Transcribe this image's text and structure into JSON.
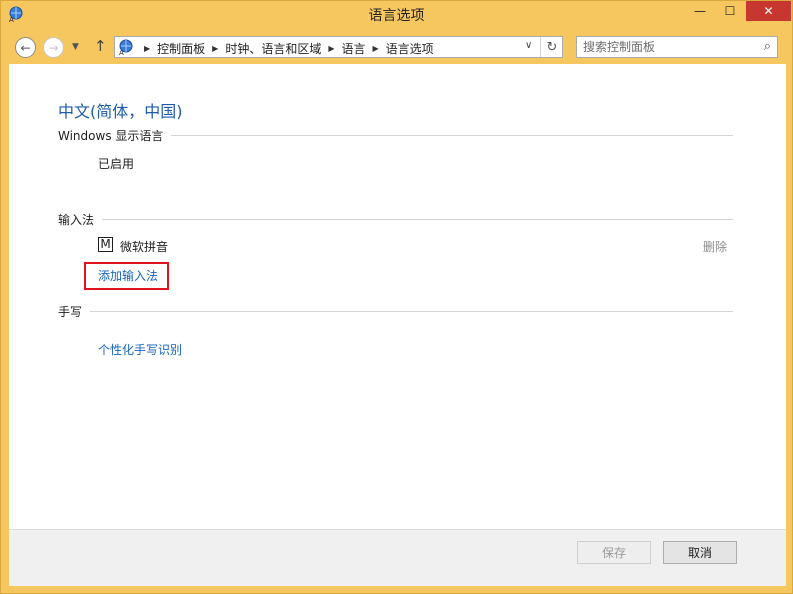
{
  "window": {
    "title": "语言选项",
    "minimize_glyph": "—",
    "maximize_glyph": "☐",
    "close_glyph": "✕"
  },
  "nav": {
    "back_glyph": "←",
    "forward_glyph": "→",
    "history_glyph": "▼",
    "up_glyph": "↑",
    "breadcrumbs": [
      "控制面板",
      "时钟、语言和区域",
      "语言",
      "语言选项"
    ],
    "separator_glyph": "▶",
    "dropdown_glyph": "∨",
    "refresh_glyph": "↻"
  },
  "search": {
    "placeholder": "搜索控制面板",
    "icon": "search-icon"
  },
  "language": {
    "title": "中文(简体，中国)"
  },
  "sections": {
    "display_language": {
      "heading": "Windows 显示语言",
      "status": "已启用"
    },
    "input_method": {
      "heading": "输入法",
      "ime_icon_letter": "M",
      "ime_name": "微软拼音",
      "remove_label": "删除",
      "add_label": "添加输入法"
    },
    "handwriting": {
      "heading": "手写",
      "personalize_label": "个性化手写识别"
    }
  },
  "footer": {
    "save_label": "保存",
    "cancel_label": "取消"
  },
  "colors": {
    "title_bar": "#f6c75e",
    "link": "#1565c0",
    "heading_blue": "#1e5bab",
    "highlight": "#e0121d",
    "close_button": "#c7372f"
  }
}
